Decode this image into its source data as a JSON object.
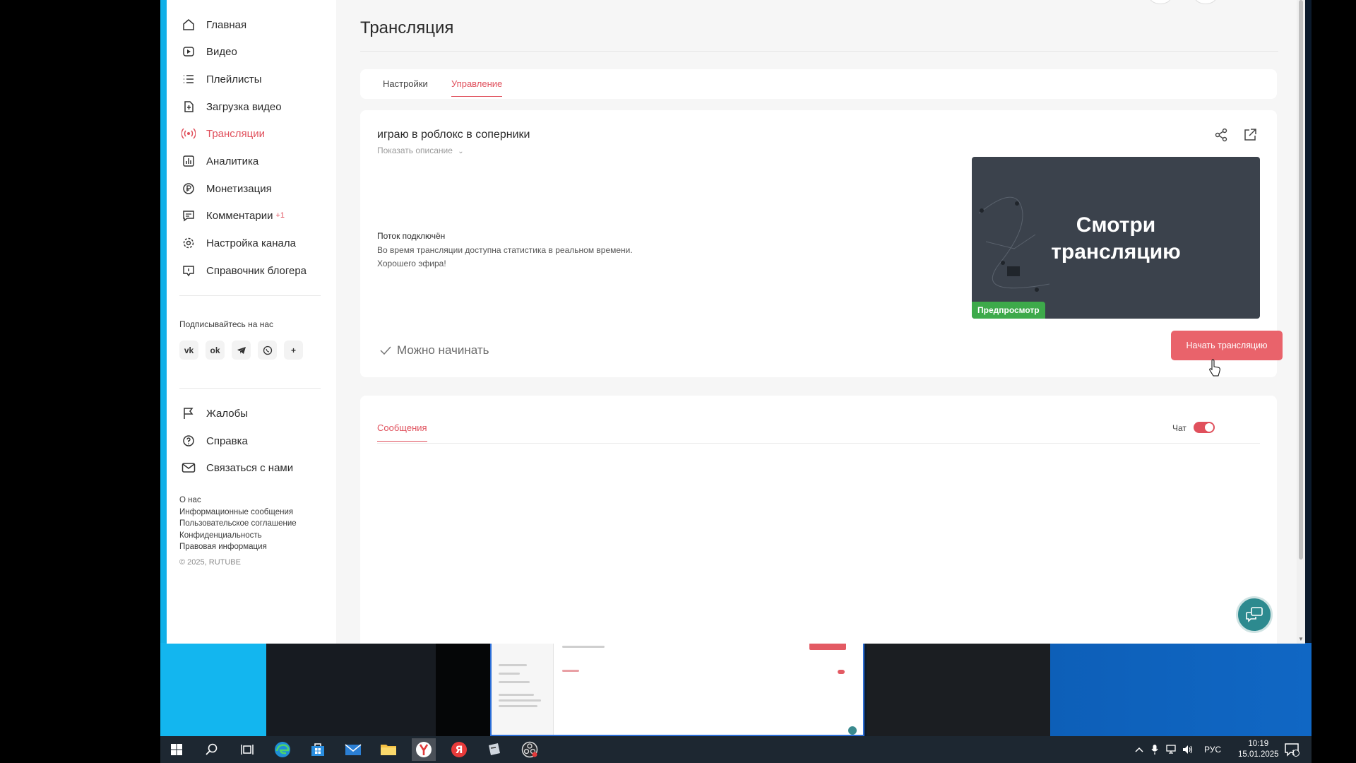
{
  "sidebar": {
    "items": [
      {
        "label": "Главная",
        "icon": "home-icon"
      },
      {
        "label": "Видео",
        "icon": "video-icon"
      },
      {
        "label": "Плейлисты",
        "icon": "list-icon"
      },
      {
        "label": "Загрузка видео",
        "icon": "upload-icon"
      },
      {
        "label": "Трансляции",
        "icon": "broadcast-icon"
      },
      {
        "label": "Аналитика",
        "icon": "analytics-icon"
      },
      {
        "label": "Монетизация",
        "icon": "ruble-icon"
      },
      {
        "label": "Комментарии",
        "icon": "comment-icon",
        "badge": "+1"
      },
      {
        "label": "Настройка канала",
        "icon": "gear-icon"
      },
      {
        "label": "Справочник блогера",
        "icon": "info-icon"
      }
    ],
    "subscribe_heading": "Подписывайтесь на нас",
    "socials": [
      "vk-icon",
      "ok-icon",
      "telegram-icon",
      "viber-icon",
      "plus-icon"
    ],
    "bottom_items": [
      {
        "label": "Жалобы",
        "icon": "flag-icon"
      },
      {
        "label": "Справка",
        "icon": "help-icon"
      },
      {
        "label": "Связаться с нами",
        "icon": "mail-icon"
      }
    ],
    "footer_links": [
      "О нас",
      "Информационные сообщения",
      "Пользовательское соглашение",
      "Конфиденциальность",
      "Правовая информация"
    ],
    "copyright": "© 2025, RUTUBE"
  },
  "main": {
    "title": "Трансляция",
    "tabs": [
      {
        "label": "Настройки",
        "active": false
      },
      {
        "label": "Управление",
        "active": true
      }
    ],
    "stream": {
      "title": "играю в роблокс в соперники",
      "show_description": "Показать описание",
      "status_title": "Поток подключён",
      "status_line1": "Во время трансляции доступна статистика в реальном времени.",
      "status_line2": "Хорошего эфира!",
      "ready_text": "Можно начинать",
      "preview_line1": "Смотри",
      "preview_line2": "трансляцию",
      "preview_badge": "Предпросмотр",
      "start_button": "Начать трансляцию"
    },
    "chat": {
      "tab": "Сообщения",
      "toggle_label": "Чат",
      "toggle_on": true
    }
  },
  "taskbar": {
    "apps": [
      "windows-start-icon",
      "search-icon",
      "task-view-icon",
      "edge-icon",
      "store-icon",
      "mail-icon",
      "explorer-icon",
      "yandex-browser-icon",
      "yandex-icon",
      "app-icon",
      "obs-icon"
    ],
    "language": "РУС",
    "time": "10:19",
    "date": "15.01.2025",
    "notification_count": "1"
  },
  "colors": {
    "accent": "#e0505c",
    "button": "#e9636b",
    "preview_badge": "#3daa4a",
    "fab": "#2d8a8f"
  }
}
